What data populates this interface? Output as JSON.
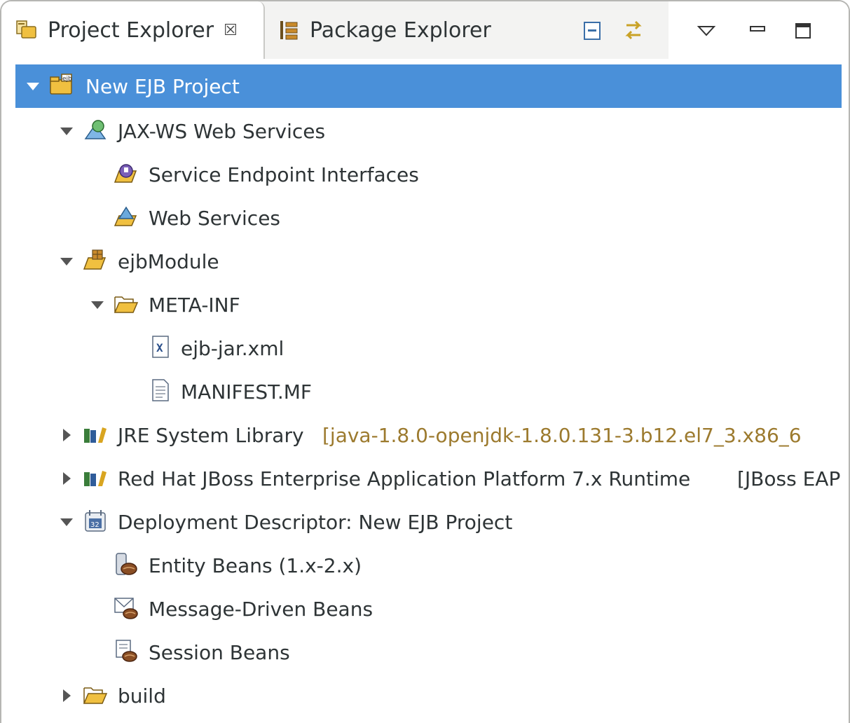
{
  "tabs": {
    "project_explorer": "Project Explorer",
    "package_explorer": "Package Explorer",
    "close_glyph": "☒"
  },
  "toolbar": {
    "collapse_all": "collapse-all-icon",
    "link_with_editor": "link-with-editor-icon",
    "view_menu": "view-menu-icon",
    "minimize": "minimize-icon",
    "maximize": "maximize-icon"
  },
  "tree": {
    "root": "New EJB Project",
    "jaxws": "JAX-WS Web Services",
    "sei": "Service Endpoint Interfaces",
    "web_services": "Web Services",
    "ejb_module": "ejbModule",
    "meta_inf": "META-INF",
    "ejb_jar": "ejb-jar.xml",
    "manifest": "MANIFEST.MF",
    "jre": "JRE System Library",
    "jre_decor": "[java-1.8.0-openjdk-1.8.0.131-3.b12.el7_3.x86_6",
    "runtime": "Red Hat JBoss Enterprise Application Platform 7.x Runtime",
    "runtime_decor": "[JBoss EAP",
    "deployment_descriptor": "Deployment Descriptor: New EJB Project",
    "entity_beans": "Entity Beans (1.x-2.x)",
    "message_driven": "Message-Driven Beans",
    "session_beans": "Session Beans",
    "build": "build"
  },
  "colors": {
    "selection": "#4a90d9",
    "decoration_text": "#9c7a2e",
    "folder": "#f0c040"
  }
}
